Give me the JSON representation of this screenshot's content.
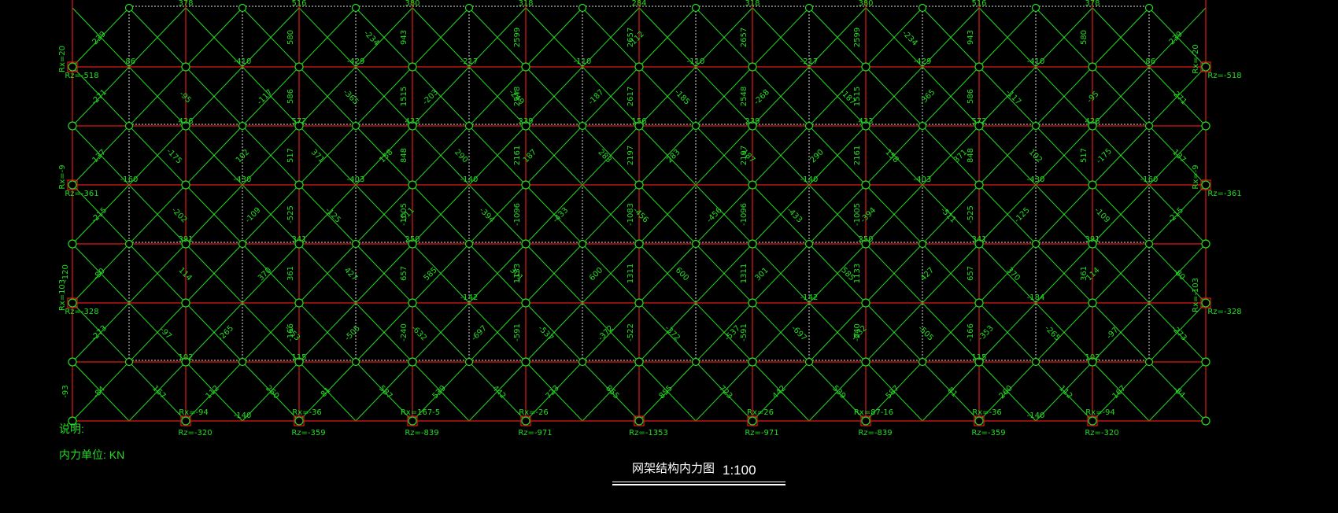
{
  "drawing": {
    "title": "网架结构内力图",
    "scale": "1:100",
    "note_label": "说明:",
    "note_unit": "内力单位: KN"
  },
  "colors": {
    "background": "#000000",
    "main_member": "#e01818",
    "diagonal": "#22dd22",
    "lower_chord": "#dddddd",
    "text": "#22dd22",
    "title": "#ffffff"
  },
  "grid": {
    "columns": 11,
    "main_rows": 7
  },
  "row_labels": [
    [
      "-86",
      "-410",
      "-429",
      "-217",
      "-110",
      "-110",
      "-217",
      "-429",
      "-410",
      "-86"
    ],
    [
      "-160",
      "-430",
      "-403",
      "-140",
      "",
      "",
      "-140",
      "-403",
      "-430",
      "-160"
    ],
    [
      "",
      "",
      "",
      "-142",
      "",
      "",
      "-142",
      "",
      "-184",
      ""
    ],
    [
      "",
      "-140",
      "",
      "",
      "",
      "",
      "",
      "",
      "-140",
      ""
    ]
  ],
  "half_labels": [
    [
      "378",
      "516",
      "380",
      "318",
      "284",
      "318",
      "380",
      "516",
      "378"
    ],
    [
      "426",
      "572",
      "433",
      "239",
      "156",
      "239",
      "433",
      "572",
      "426"
    ],
    [
      "391",
      "341",
      "250",
      "",
      "",
      "",
      "250",
      "341",
      "391"
    ],
    [
      "102",
      "115",
      "",
      "",
      "",
      "",
      "",
      "115",
      "102"
    ]
  ],
  "vertical_labels": [
    [
      "580",
      "943",
      "2599",
      "2657",
      "2657",
      "2599",
      "943",
      "580"
    ],
    [
      "586",
      "1515",
      "2548",
      "2617",
      "2548",
      "1515",
      "586"
    ],
    [
      "517",
      "848",
      "2161",
      "2197",
      "2197",
      "2161",
      "848",
      "517"
    ],
    [
      "-525",
      "-1005",
      "-1096",
      "-1083",
      "-1096",
      "-1005",
      "-525"
    ],
    [
      "361",
      "657",
      "1133",
      "1311",
      "1311",
      "1133",
      "657",
      "361"
    ],
    [
      "-166",
      "-240",
      "-591",
      "-522",
      "-591",
      "-240",
      "-166"
    ]
  ],
  "diag_labels": [
    [
      "239",
      "-234",
      "112",
      "-234",
      "239"
    ],
    [
      "-271",
      "-95",
      "-117",
      "-365",
      "-203",
      "-249",
      "-187",
      "-185",
      "-268",
      "-187",
      "-365",
      "-117",
      "-95",
      "-271"
    ],
    [
      "137",
      "-175",
      "102",
      "371",
      "158",
      "290",
      "187",
      "283",
      "283",
      "187",
      "290",
      "158",
      "371",
      "102",
      "-175",
      "137"
    ],
    [
      "-215",
      "-202",
      "-109",
      "-125",
      "-511",
      "-394",
      "-433",
      "-456",
      "-456",
      "-433",
      "-394",
      "-511",
      "-125",
      "-109",
      "-215"
    ],
    [
      "-80",
      "114",
      "370",
      "427",
      "585",
      "301",
      "600",
      "600",
      "301",
      "585",
      "427",
      "370",
      "114",
      "-80"
    ],
    [
      "-273",
      "-97",
      "-265",
      "-353",
      "-505",
      "-632",
      "-697",
      "-537",
      "-372",
      "-372",
      "-537",
      "-697",
      "-632",
      "-505",
      "-353",
      "-265",
      "-97",
      "-273"
    ],
    [
      "-84",
      "167",
      "112",
      "260",
      "81",
      "587",
      "539",
      "442",
      "723",
      "855",
      "855",
      "723",
      "442",
      "539",
      "587",
      "81",
      "260",
      "112",
      "167",
      "-84"
    ]
  ],
  "left_labels": [
    "-120",
    "-93"
  ],
  "supports": {
    "left": [
      {
        "rx": "Rx=20",
        "rz": "Rz=-518"
      },
      {
        "rx": "Rx=-9",
        "rz": "Rz=-361"
      },
      {
        "rx": "Rx=103",
        "rz": "Rz=-328"
      }
    ],
    "right": [
      {
        "rx": "Rx=-20",
        "rz": "Rz=-518"
      },
      {
        "rx": "Rx=-9",
        "rz": "Rz=-361"
      },
      {
        "rx": "Rx=-103",
        "rz": "Rz=-328"
      }
    ],
    "bottom": [
      {
        "rx": "",
        "rz": ""
      },
      {
        "rx": "Rx=-94",
        "rz": "Rz=-320"
      },
      {
        "rx": "Rx=-36",
        "rz": "Rz=-359"
      },
      {
        "rx": "Rx=167-5",
        "rz": "Rz=-839"
      },
      {
        "rx": "Rx=-26",
        "rz": "Rz=-971"
      },
      {
        "rx": "",
        "rz": "Rz=-1353"
      },
      {
        "rx": "Rx=26",
        "rz": "Rz=-971"
      },
      {
        "rx": "Rx=87-16",
        "rz": "Rz=-839"
      },
      {
        "rx": "Rx=-36",
        "rz": "Rz=-359"
      },
      {
        "rx": "Rx=-94",
        "rz": "Rz=-320"
      },
      {
        "rx": "",
        "rz": ""
      }
    ]
  }
}
